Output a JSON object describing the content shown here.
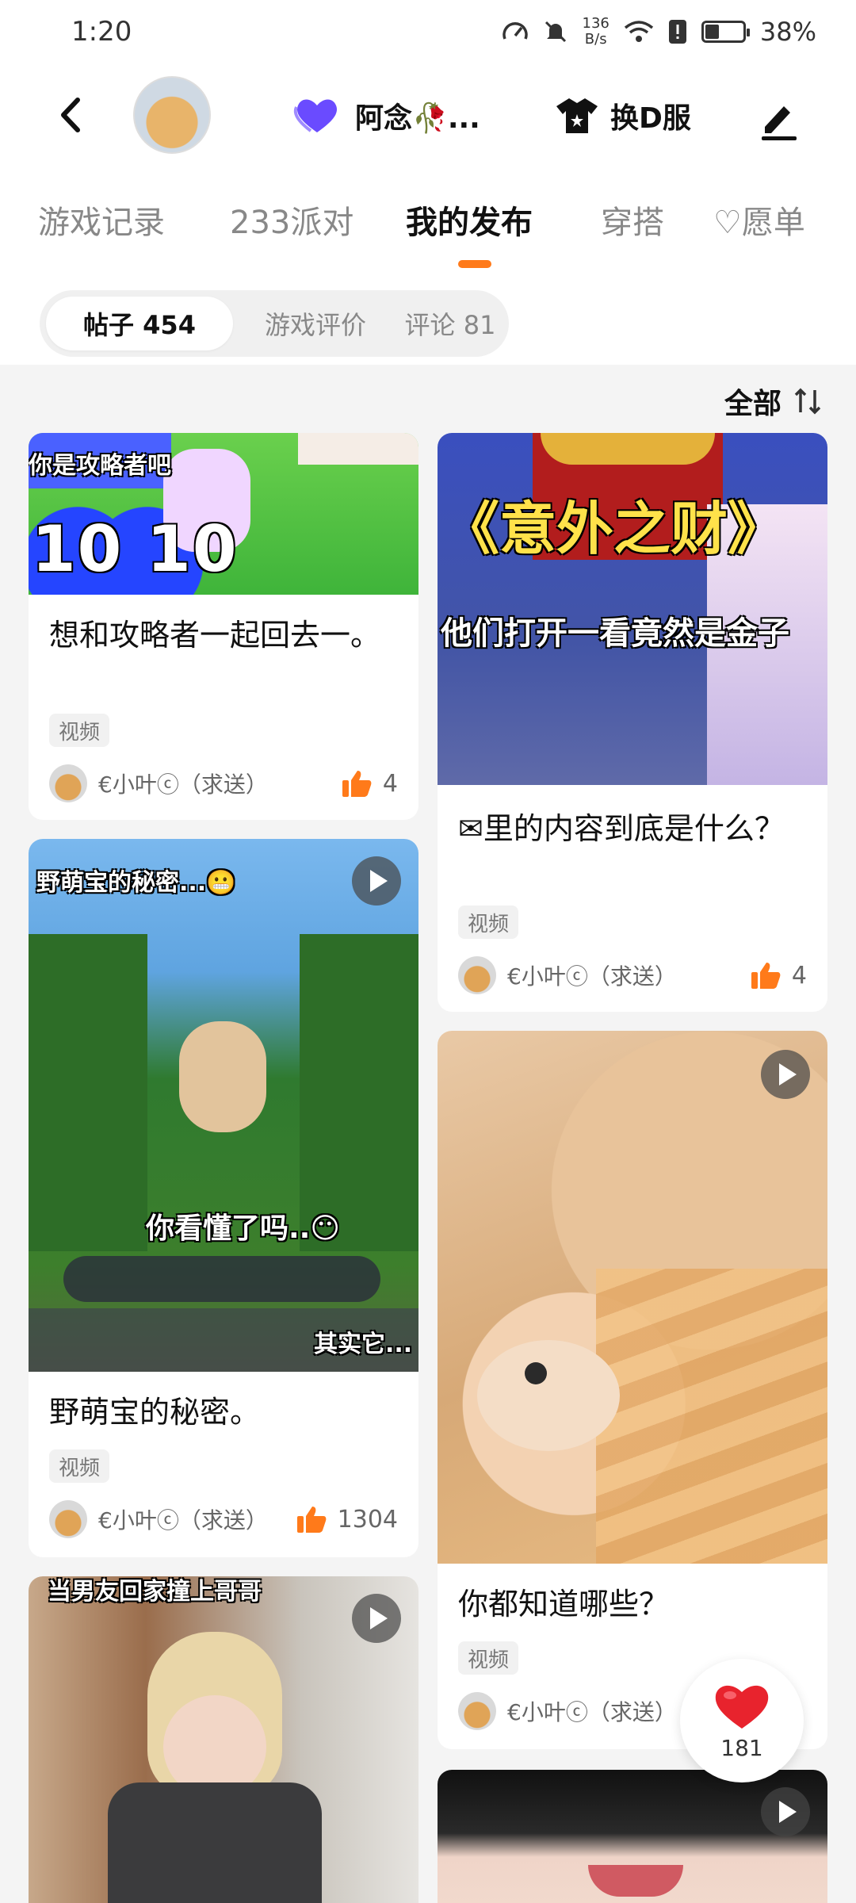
{
  "status": {
    "time": "1:20",
    "speed_top": "136",
    "speed_bottom": "B/s",
    "battery": "38%",
    "battery_level": 0.38
  },
  "header": {
    "user_name": "阿念🥀...",
    "outfit_label": "换D服"
  },
  "tabs": [
    "游戏记录",
    "233派对",
    "我的发布",
    "穿搭",
    "♡愿单"
  ],
  "active_tab": "我的发布",
  "subtabs": [
    "帖子 454",
    "游戏评价",
    "评论 81"
  ],
  "sort_label": "全部",
  "posts": [
    {
      "title": "想和攻略者一起回去一。",
      "tag": "视频",
      "author": "€小叶ⓒ（求送）",
      "likes": "4",
      "overlay": [
        "你是攻略者吧",
        "10 10"
      ]
    },
    {
      "title": "✉里的内容到底是什么？",
      "tag": "视频",
      "author": "€小叶ⓒ（求送）",
      "likes": "4",
      "overlay": [
        "《意外之财》",
        "他们打开一看竟然是金子"
      ]
    },
    {
      "title": "野萌宝的秘密。",
      "tag": "视频",
      "author": "€小叶ⓒ（求送）",
      "likes": "1304",
      "overlay": [
        "野萌宝的秘密...😬",
        "你看懂了吗..😶",
        "其实它..."
      ]
    },
    {
      "title": "你都知道哪些？",
      "tag": "视频",
      "author": "€小叶ⓒ（求送）",
      "likes": "",
      "overlay": []
    },
    {
      "title": "",
      "tag": "",
      "author": "",
      "likes": "",
      "overlay": [
        "当男友回家撞上哥哥"
      ]
    }
  ],
  "float_like_count": "181",
  "colors": {
    "accent": "#ff7a1a",
    "heart": "#e8232d",
    "purple_heart": "#6a4bff"
  }
}
